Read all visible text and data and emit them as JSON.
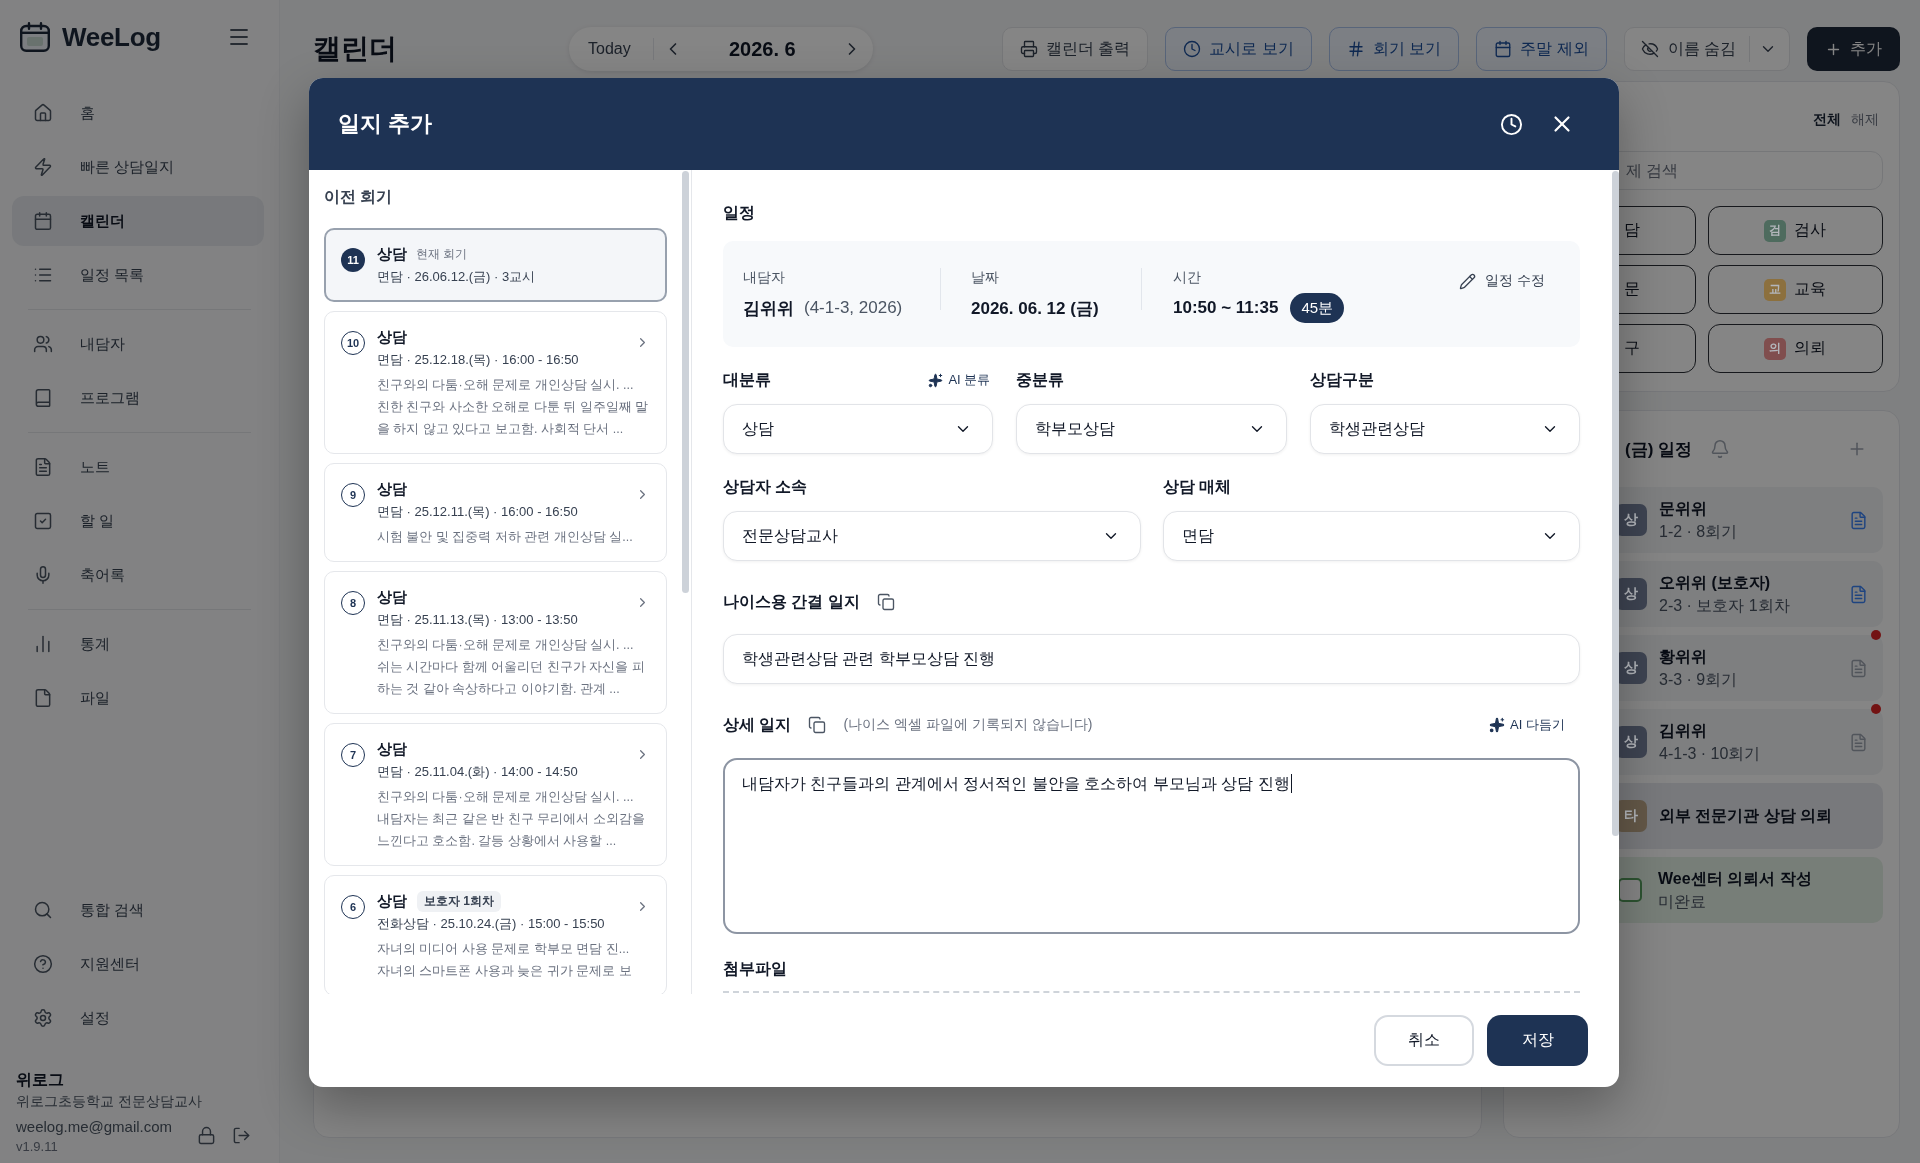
{
  "sidebar": {
    "logo": "WeeLog",
    "nav_groups": [
      [
        {
          "label": "홈",
          "selected": false
        },
        {
          "label": "빠른 상담일지",
          "selected": false
        },
        {
          "label": "캘린더",
          "selected": true
        },
        {
          "label": "일정 목록",
          "selected": false
        }
      ],
      [
        {
          "label": "내담자",
          "selected": false
        },
        {
          "label": "프로그램",
          "selected": false
        }
      ],
      [
        {
          "label": "노트",
          "selected": false
        },
        {
          "label": "할 일",
          "selected": false
        },
        {
          "label": "축어록",
          "selected": false
        }
      ],
      [
        {
          "label": "통계",
          "selected": false
        },
        {
          "label": "파일",
          "selected": false
        }
      ]
    ],
    "bottom_items": [
      {
        "label": "통합 검색"
      },
      {
        "label": "지원센터"
      },
      {
        "label": "설정"
      }
    ],
    "user": {
      "name": "위로그",
      "role": "위로그초등학교 전문상담교사",
      "email": "weelog.me@gmail.com",
      "version": "v1.9.11"
    }
  },
  "header": {
    "title": "캘린더",
    "today": "Today",
    "month": "2026. 6",
    "actions": [
      {
        "label": "캘린더 출력",
        "on": false
      },
      {
        "label": "교시로 보기",
        "on": true
      },
      {
        "label": "회기 보기",
        "on": true
      },
      {
        "label": "주말 제외",
        "on": true
      }
    ],
    "name_toggle": "이름 숨김",
    "add": "추가"
  },
  "filter_panel": {
    "select_all": "전체",
    "clear": "해제",
    "search_placeholder": "제 검색",
    "categories": [
      {
        "label": "담"
      },
      {
        "badge": "검",
        "label": "검사",
        "color": "#4e6b5e"
      },
      {
        "label": "문"
      },
      {
        "badge": "교",
        "label": "교육",
        "color": "#8c703e"
      },
      {
        "label": "구"
      },
      {
        "badge": "의",
        "label": "의뢰",
        "color": "#804e4e"
      }
    ]
  },
  "day_schedule": {
    "title": "(금) 일정",
    "items": [
      {
        "kind": "session",
        "badge": "상",
        "color": "#3e4452",
        "name": "문위위",
        "detail": "1-2 · 8회기",
        "has_log": true,
        "alert": false
      },
      {
        "kind": "session",
        "badge": "상",
        "color": "#3e4452",
        "name": "오위위 (보호자)",
        "detail": "2-3 · 보호자 1회차",
        "has_log": true,
        "alert": false
      },
      {
        "kind": "session",
        "badge": "상",
        "color": "#3e4452",
        "name": "황위위",
        "detail": "3-3 · 9회기",
        "has_log": false,
        "alert": true
      },
      {
        "kind": "session",
        "badge": "상",
        "color": "#3e4452",
        "name": "김위위",
        "detail": "4-1-3 · 10회기",
        "has_log": false,
        "alert": true
      },
      {
        "kind": "event",
        "badge": "타",
        "color": "#645848",
        "name": "외부 전문기관 상담 의뢰"
      },
      {
        "kind": "todo",
        "name": "Wee센터 의뢰서 작성",
        "detail": "미완료",
        "done": false
      }
    ]
  },
  "modal": {
    "title": "일지 추가",
    "history": {
      "title": "이전 회기",
      "sessions": [
        {
          "number": "11",
          "title": "상담",
          "tag": {
            "text": "현재 회기",
            "kind": "note"
          },
          "meta": "면담 · 26.06.12.(금) · 3교시",
          "selected": true
        },
        {
          "number": "10",
          "title": "상담",
          "meta": "면담 · 25.12.18.(목) · 16:00 - 16:50",
          "summary": "친구와의 다툼·오해 문제로 개인상담 실시. ...",
          "detail": "친한 친구와 사소한 오해로 다툰 뒤 일주일째 말을 하지 않고 있다고 보고함. 사회적 단서 ...",
          "selected": false
        },
        {
          "number": "9",
          "title": "상담",
          "meta": "면담 · 25.12.11.(목) · 16:00 - 16:50",
          "summary": "시험 불안 및 집중력 저하 관련 개인상담 실...",
          "selected": false
        },
        {
          "number": "8",
          "title": "상담",
          "meta": "면담 · 25.11.13.(목) · 13:00 - 13:50",
          "summary": "친구와의 다툼·오해 문제로 개인상담 실시. ...",
          "detail": "쉬는 시간마다 함께 어울리던 친구가 자신을 피하는 것 같아 속상하다고 이야기함. 관계 ...",
          "selected": false
        },
        {
          "number": "7",
          "title": "상담",
          "meta": "면담 · 25.11.04.(화) · 14:00 - 14:50",
          "summary": "친구와의 다툼·오해 문제로 개인상담 실시. ...",
          "detail": "내담자는 최근 같은 반 친구 무리에서 소외감을 느낀다고 호소함. 갈등 상황에서 사용할 ...",
          "selected": false
        },
        {
          "number": "6",
          "title": "상담",
          "tag": {
            "text": "보호자 1회차",
            "kind": "chip"
          },
          "meta": "전화상담 · 25.10.24.(금) · 15:00 - 15:50",
          "summary": "자녀의 미디어 사용 문제로 학부모 면담 진...",
          "detail": "자녀의 스마트폰 사용과 늦은 귀가 문제로 보",
          "selected": false
        }
      ]
    },
    "schedule": {
      "title": "일정",
      "client_label": "내담자",
      "client_name": "김위위",
      "client_info": "(4-1-3, 2026)",
      "date_label": "날짜",
      "date": "2026. 06. 12 (금)",
      "time_label": "시간",
      "time": "10:50 ~ 11:35",
      "duration": "45분",
      "edit": "일정 수정"
    },
    "classification": [
      {
        "label": "대분류",
        "value": "상담",
        "ai": "AI 분류"
      },
      {
        "label": "중분류",
        "value": "학부모상담"
      },
      {
        "label": "상담구분",
        "value": "학생관련상담"
      }
    ],
    "assignment": [
      {
        "label": "상담자 소속",
        "value": "전문상담교사"
      },
      {
        "label": "상담 매체",
        "value": "면담"
      }
    ],
    "brief_log": {
      "label": "나이스용 간결 일지",
      "value": "학생관련상담 관련 학부모상담 진행"
    },
    "detail_log": {
      "label": "상세 일지",
      "note": "(나이스 엑셀 파일에 기록되지 않습니다)",
      "ai": "AI 다듬기",
      "value": "내담자가 친구들과의 관계에서 정서적인 불안을 호소하여 부모님과 상담 진행",
      "focused": true
    },
    "attachments": {
      "label": "첨부파일"
    },
    "cancel": "취소",
    "save": "저장"
  }
}
